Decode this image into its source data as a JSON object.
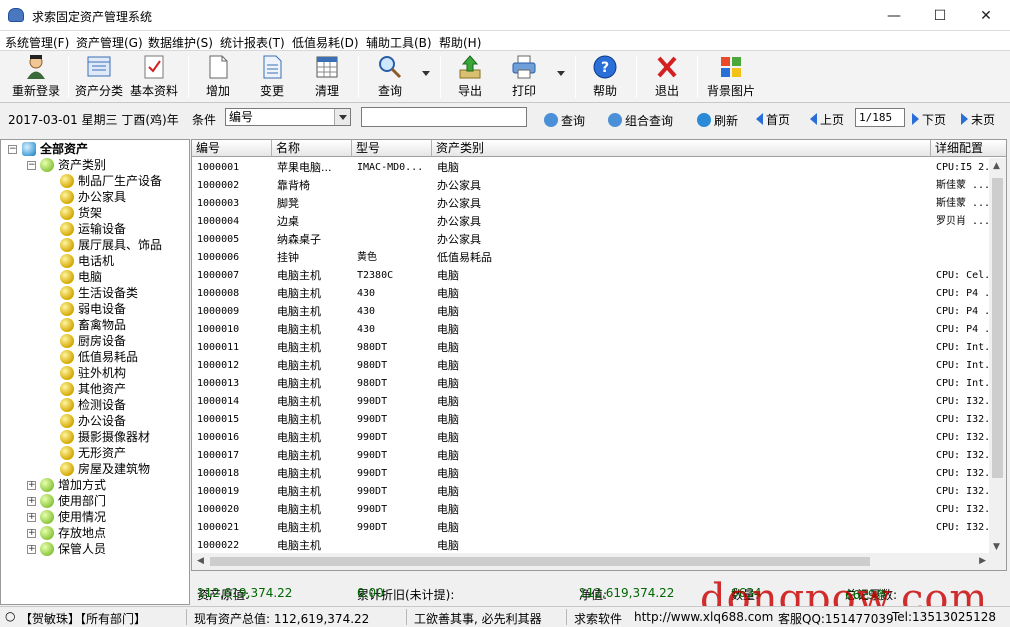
{
  "window": {
    "title": "求索固定资产管理系统",
    "minimize": "—",
    "maximize": "☐",
    "close": "✕"
  },
  "menu": [
    "系统管理(F)",
    "资产管理(G)",
    "数据维护(S)",
    "统计报表(T)",
    "低值易耗(D)",
    "辅助工具(B)",
    "帮助(H)"
  ],
  "toolbar": {
    "relogin": "重新登录",
    "asset_class": "资产分类",
    "basic_data": "基本资料",
    "add": "增加",
    "change": "变更",
    "clear": "清理",
    "query": "查询",
    "export": "导出",
    "print": "打印",
    "help": "帮助",
    "exit": "退出",
    "background": "背景图片"
  },
  "querybar": {
    "date": "2017-03-01 星期三 丁酉(鸡)年",
    "condition_label": "条件",
    "condition_value": "编号",
    "query": "查询",
    "combined_query": "组合查询",
    "refresh": "刷新",
    "first": "首页",
    "prev": "上页",
    "page": "1/185",
    "next": "下页",
    "last": "末页"
  },
  "tree": {
    "root": "全部资产",
    "category_root": "资产类别",
    "categories": [
      "制品厂生产设备",
      "办公家具",
      "货架",
      "运输设备",
      "展厅展具、饰品",
      "电话机",
      "电脑",
      "生活设备类",
      "弱电设备",
      "畜禽物品",
      "厨房设备",
      "低值易耗品",
      "驻外机构",
      "其他资产",
      "检测设备",
      "办公设备",
      "摄影摄像器材",
      "无形资产",
      "房屋及建筑物"
    ],
    "others": [
      "增加方式",
      "使用部门",
      "使用情况",
      "存放地点",
      "保管人员"
    ]
  },
  "table": {
    "headers": [
      "编号",
      "名称",
      "型号",
      "资产类别",
      "详细配置"
    ],
    "rows": [
      [
        "1000001",
        "苹果电脑...",
        "IMAC-MD0...",
        "电脑",
        "CPU:I5 2..."
      ],
      [
        "1000002",
        "靠背椅",
        "",
        "办公家具",
        "斯佳蒙 ..."
      ],
      [
        "1000003",
        "脚凳",
        "",
        "办公家具",
        "斯佳蒙 ..."
      ],
      [
        "1000004",
        "边桌",
        "",
        "办公家具",
        "罗贝肖 ..."
      ],
      [
        "1000005",
        "纳森桌子",
        "",
        "办公家具",
        ""
      ],
      [
        "1000006",
        "挂钟",
        "黄色",
        "低值易耗品",
        ""
      ],
      [
        "1000007",
        "电脑主机",
        "T2380C",
        "电脑",
        "CPU: Cel..."
      ],
      [
        "1000008",
        "电脑主机",
        "430",
        "电脑",
        "CPU: P4 ..."
      ],
      [
        "1000009",
        "电脑主机",
        "430",
        "电脑",
        "CPU: P4 ..."
      ],
      [
        "1000010",
        "电脑主机",
        "430",
        "电脑",
        "CPU: P4 ..."
      ],
      [
        "1000011",
        "电脑主机",
        "980DT",
        "电脑",
        "CPU: Int..."
      ],
      [
        "1000012",
        "电脑主机",
        "980DT",
        "电脑",
        "CPU: Int..."
      ],
      [
        "1000013",
        "电脑主机",
        "980DT",
        "电脑",
        "CPU: Int..."
      ],
      [
        "1000014",
        "电脑主机",
        "990DT",
        "电脑",
        "CPU: I32..."
      ],
      [
        "1000015",
        "电脑主机",
        "990DT",
        "电脑",
        "CPU: I32..."
      ],
      [
        "1000016",
        "电脑主机",
        "990DT",
        "电脑",
        "CPU: I32..."
      ],
      [
        "1000017",
        "电脑主机",
        "990DT",
        "电脑",
        "CPU: I32..."
      ],
      [
        "1000018",
        "电脑主机",
        "990DT",
        "电脑",
        "CPU: I32..."
      ],
      [
        "1000019",
        "电脑主机",
        "990DT",
        "电脑",
        "CPU: I32..."
      ],
      [
        "1000020",
        "电脑主机",
        "990DT",
        "电脑",
        "CPU: I32..."
      ],
      [
        "1000021",
        "电脑主机",
        "990DT",
        "电脑",
        "CPU: I32..."
      ],
      [
        "1000022",
        "电脑主机",
        "",
        "电脑",
        ""
      ]
    ]
  },
  "summary": {
    "original_label": "资产原值:",
    "original_value": "112,619,374.22",
    "depr_label": "累计折旧(未计提):",
    "depr_value": "0.00",
    "net_label": "净值:",
    "net_value": "112,619,374.22",
    "qty_label": "数量:",
    "qty_value": "6634",
    "total_label": "总记录数:",
    "total_value": "6629条"
  },
  "status": {
    "user": "【贺敏珠】【所有部门】",
    "total": "现有资产总值: 112,619,374.22",
    "motto": "工欲善其事, 必先利其器",
    "company": "求索软件",
    "url": "http://www.xlq688.com",
    "qq": "客服QQ:151477039",
    "tel": "Tel:13513025128"
  },
  "watermark": "dongpow.com"
}
